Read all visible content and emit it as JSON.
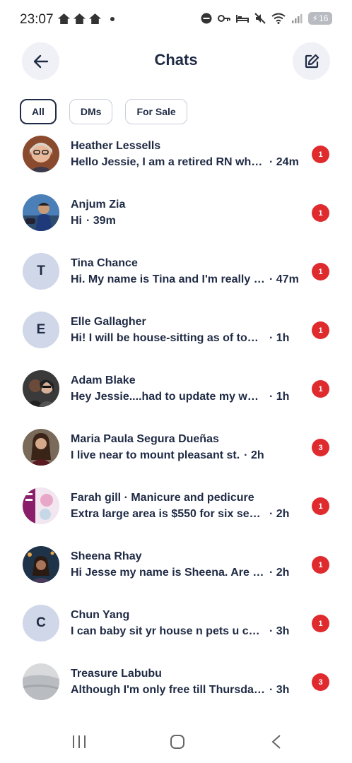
{
  "status_bar": {
    "time": "23:07",
    "battery": "16"
  },
  "header": {
    "title": "Chats"
  },
  "filters": [
    {
      "label": "All",
      "active": true
    },
    {
      "label": "DMs",
      "active": false
    },
    {
      "label": "For Sale",
      "active": false
    }
  ],
  "chats": [
    {
      "name": "Heather Lessells",
      "preview": "Hello Jessie, I am a retired RN who ...",
      "time": "· 24m",
      "unread": "1",
      "avatar": "photo"
    },
    {
      "name": "Anjum Zia",
      "preview": "Hi",
      "time": "· 39m",
      "unread": "1",
      "avatar": "photo"
    },
    {
      "name": "Tina Chance",
      "preview": "Hi. My name is Tina and I'm really in...",
      "time": "· 47m",
      "unread": "1",
      "avatar": "T"
    },
    {
      "name": "Elle Gallagher",
      "preview": "Hi! I will be house-sitting as of tomorr...",
      "time": "· 1h",
      "unread": "1",
      "avatar": "E"
    },
    {
      "name": "Adam Blake",
      "preview": "Hey Jessie....had to update my whats...",
      "time": "· 1h",
      "unread": "1",
      "avatar": "photo"
    },
    {
      "name": "Maria Paula Segura Dueñas",
      "preview": "I live near to mount pleasant st.",
      "time": "· 2h",
      "unread": "3",
      "avatar": "photo"
    },
    {
      "name": "Farah gill · Manicure and pedicure",
      "preview": "Extra large area is $550 for six sessio...",
      "time": "· 2h",
      "unread": "1",
      "avatar": "photo"
    },
    {
      "name": "Sheena Rhay",
      "preview": "Hi Jesse my name is Sheena. Are you ...",
      "time": "· 2h",
      "unread": "1",
      "avatar": "photo"
    },
    {
      "name": "Chun Yang",
      "preview": "I can baby sit yr house n pets u can re...",
      "time": "· 3h",
      "unread": "1",
      "avatar": "C"
    },
    {
      "name": "Treasure Labubu",
      "preview": "Although I'm only free till Thursday s...",
      "time": "· 3h",
      "unread": "3",
      "avatar": "photo"
    }
  ]
}
